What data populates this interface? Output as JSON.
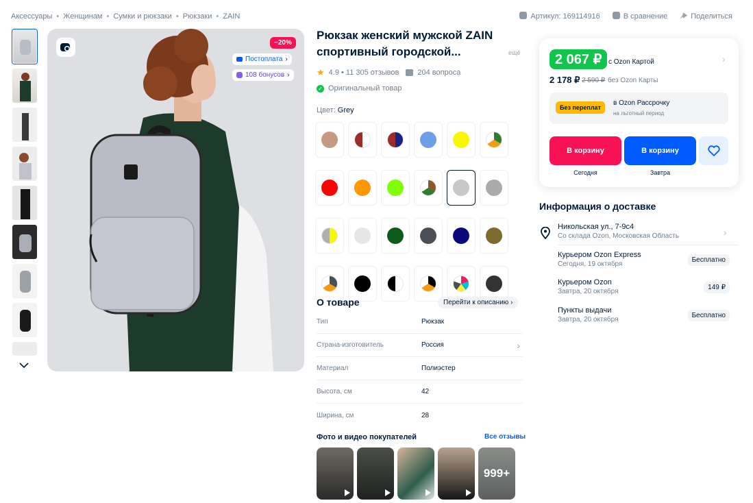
{
  "breadcrumbs": [
    "Аксессуары",
    "Женщинам",
    "Сумки и рюкзаки",
    "Рюкзаки",
    "ZAIN"
  ],
  "top_actions": {
    "article": "Артикул: 169114916",
    "compare": "В сравнение",
    "share": "Поделиться"
  },
  "gallery": {
    "discount": "−20%",
    "badge_postpay": "Постоплата",
    "badge_bonus": "108 бонусов"
  },
  "product": {
    "title": "Рюкзак женский мужской ZAIN спортивный городской...",
    "more": "ещё",
    "rating": "4.9 • 11 305 отзывов",
    "questions": "204 вопроса",
    "original": "Оригинальный товар",
    "color_label": "Цвет:",
    "color_value": "Grey"
  },
  "colors": [
    "#c49a80",
    "split:#9b2c2c",
    "split:#9b2c2c|#1a237e",
    "#6f9ee8",
    "#f7f700",
    "tri:#2e7d32|#f39c12|#fff",
    "#ff0000",
    "#ff9800",
    "#7fff00",
    "tri:#8b5a2b|#2e7d32|#fff",
    "#c8c8c8",
    "#ababab",
    "split:#b0b0b0|#f7f700",
    "#e6e6e6",
    "#0b5a1a",
    "#4a4f57",
    "#0a0a7a",
    "#7d6b2e",
    "tri:#4a4f57|#f39c12|#fff",
    "#000000",
    "split:#000|#fff",
    "tri:#000|#f39c12|#fff",
    "pie:#e91e63",
    "#333333"
  ],
  "about": {
    "title": "О товаре",
    "link": "Перейти к описанию"
  },
  "specs": [
    {
      "k": "Тип",
      "v": "Рюкзак"
    },
    {
      "k": "Страна-изготовитель",
      "v": "Россия"
    },
    {
      "k": "Материал",
      "v": "Полиэстер"
    },
    {
      "k": "Высота, см",
      "v": "42"
    },
    {
      "k": "Ширина, см",
      "v": "28"
    }
  ],
  "photos": {
    "title": "Фото и видео покупателей",
    "all": "Все отзывы",
    "count": "999+"
  },
  "price": {
    "card_price": "2 067 ₽",
    "card_label": "с Ozon Картой",
    "price": "2 178 ₽",
    "old": "2 590 ₽",
    "no_card": "без Ozon Карты",
    "badge": "Без переплат",
    "inst_title": "в Ozon Рассрочку",
    "inst_sub": "на льготный период",
    "cart1": "В корзину",
    "cart1_sub": "Сегодня",
    "cart2": "В корзину",
    "cart2_sub": "Завтра"
  },
  "delivery": {
    "title": "Информация о доставке",
    "address": "Никольская ул., 7-9с4",
    "address_sub": "Со склада Ozon, Московская Область",
    "options": [
      {
        "name": "Курьером Ozon Express",
        "date": "Сегодня, 19 октября",
        "price": "Бесплатно"
      },
      {
        "name": "Курьером Ozon",
        "date": "Завтра, 20 октября",
        "price": "149 ₽"
      },
      {
        "name": "Пункты выдачи",
        "date": "Завтра, 20 октября",
        "price": "Бесплатно"
      }
    ]
  }
}
